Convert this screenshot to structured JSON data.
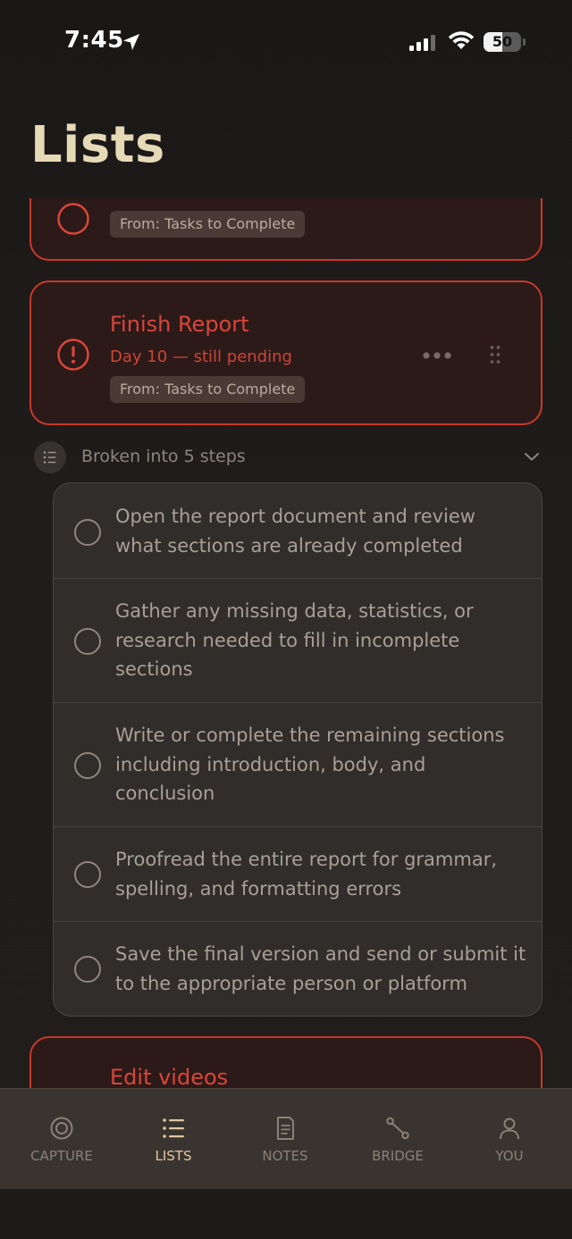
{
  "status_bar": {
    "time": "7:45",
    "battery": "50"
  },
  "page": {
    "title": "Lists"
  },
  "previous_task": {
    "from_label": "From: Tasks to Complete"
  },
  "task": {
    "title": "Finish Report",
    "subtitle": "Day 10 — still pending",
    "from_label": "From: Tasks to Complete"
  },
  "steps": {
    "header": "Broken into 5 steps",
    "items": [
      {
        "text": "Open the report document and review what sections are already completed"
      },
      {
        "text": "Gather any missing data, statistics, or research needed to fill in incomplete sections"
      },
      {
        "text": "Write or complete the remaining sections including introduction, body, and conclusion"
      },
      {
        "text": "Proofread the entire report for grammar, spelling, and formatting errors"
      },
      {
        "text": "Save the final version and send or submit it to the appropriate person or platform"
      }
    ]
  },
  "next_task": {
    "title": "Edit videos"
  },
  "tabs": [
    {
      "label": "CAPTURE",
      "icon": "target-icon",
      "active": false
    },
    {
      "label": "LISTS",
      "icon": "list-icon",
      "active": true
    },
    {
      "label": "NOTES",
      "icon": "document-icon",
      "active": false
    },
    {
      "label": "BRIDGE",
      "icon": "bridge-icon",
      "active": false
    },
    {
      "label": "YOU",
      "icon": "person-icon",
      "active": false
    }
  ],
  "colors": {
    "accent_red": "#d9463a",
    "title_cream": "#e6d9b6",
    "active_tab": "#e3c7a0",
    "background": "#1e1b19"
  }
}
